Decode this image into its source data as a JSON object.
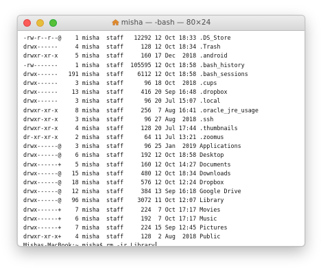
{
  "window": {
    "title": "misha — -bash — 80×24"
  },
  "icons": {
    "title_icon": "home-folder-icon"
  },
  "listing": [
    {
      "perms": "-rw-r--r--@",
      "links": "1",
      "owner": "misha",
      "group": "staff",
      "size": "12292",
      "month": "12",
      "day": "Oct",
      "time": "18:33",
      "name": ".DS_Store"
    },
    {
      "perms": "drwx------",
      "links": "4",
      "owner": "misha",
      "group": "staff",
      "size": "128",
      "month": "12",
      "day": "Oct",
      "time": "18:34",
      "name": ".Trash"
    },
    {
      "perms": "drwxr-xr-x",
      "links": "5",
      "owner": "misha",
      "group": "staff",
      "size": "160",
      "month": "17",
      "day": "Dec",
      "time": " 2018",
      "name": ".android"
    },
    {
      "perms": "-rw-------",
      "links": "1",
      "owner": "misha",
      "group": "staff",
      "size": "105595",
      "month": "12",
      "day": "Oct",
      "time": "18:58",
      "name": ".bash_history"
    },
    {
      "perms": "drwx------",
      "links": "191",
      "owner": "misha",
      "group": "staff",
      "size": "6112",
      "month": "12",
      "day": "Oct",
      "time": "18:58",
      "name": ".bash_sessions"
    },
    {
      "perms": "drwx------",
      "links": "3",
      "owner": "misha",
      "group": "staff",
      "size": "96",
      "month": "18",
      "day": "Oct",
      "time": " 2018",
      "name": ".cups"
    },
    {
      "perms": "drwx------",
      "links": "13",
      "owner": "misha",
      "group": "staff",
      "size": "416",
      "month": "20",
      "day": "Sep",
      "time": "16:48",
      "name": ".dropbox"
    },
    {
      "perms": "drwx------",
      "links": "3",
      "owner": "misha",
      "group": "staff",
      "size": "96",
      "month": "20",
      "day": "Jul",
      "time": "15:07",
      "name": ".local"
    },
    {
      "perms": "drwxr-xr-x",
      "links": "8",
      "owner": "misha",
      "group": "staff",
      "size": "256",
      "month": " 7",
      "day": "Aug",
      "time": "16:41",
      "name": ".oracle_jre_usage"
    },
    {
      "perms": "drwxr-xr-x",
      "links": "3",
      "owner": "misha",
      "group": "staff",
      "size": "96",
      "month": "27",
      "day": "Aug",
      "time": " 2018",
      "name": ".ssh"
    },
    {
      "perms": "drwxr-xr-x",
      "links": "4",
      "owner": "misha",
      "group": "staff",
      "size": "128",
      "month": "20",
      "day": "Jul",
      "time": "17:44",
      "name": ".thumbnails"
    },
    {
      "perms": "dr-xr-xr-x",
      "links": "2",
      "owner": "misha",
      "group": "staff",
      "size": "64",
      "month": "11",
      "day": "Jul",
      "time": "13:21",
      "name": ".zoomus"
    },
    {
      "perms": "drwx------@",
      "links": "3",
      "owner": "misha",
      "group": "staff",
      "size": "96",
      "month": "25",
      "day": "Jan",
      "time": " 2019",
      "name": "Applications"
    },
    {
      "perms": "drwx------@",
      "links": "6",
      "owner": "misha",
      "group": "staff",
      "size": "192",
      "month": "12",
      "day": "Oct",
      "time": "18:58",
      "name": "Desktop"
    },
    {
      "perms": "drwx------+",
      "links": "5",
      "owner": "misha",
      "group": "staff",
      "size": "160",
      "month": "12",
      "day": "Oct",
      "time": "14:27",
      "name": "Documents"
    },
    {
      "perms": "drwx------@",
      "links": "15",
      "owner": "misha",
      "group": "staff",
      "size": "480",
      "month": "12",
      "day": "Oct",
      "time": "18:34",
      "name": "Downloads"
    },
    {
      "perms": "drwx------@",
      "links": "18",
      "owner": "misha",
      "group": "staff",
      "size": "576",
      "month": "12",
      "day": "Oct",
      "time": "12:24",
      "name": "Dropbox"
    },
    {
      "perms": "drwx------@",
      "links": "12",
      "owner": "misha",
      "group": "staff",
      "size": "384",
      "month": "13",
      "day": "Sep",
      "time": "16:18",
      "name": "Google Drive"
    },
    {
      "perms": "drwx------@",
      "links": "96",
      "owner": "misha",
      "group": "staff",
      "size": "3072",
      "month": "11",
      "day": "Oct",
      "time": "12:07",
      "name": "Library"
    },
    {
      "perms": "drwx------+",
      "links": "7",
      "owner": "misha",
      "group": "staff",
      "size": "224",
      "month": " 7",
      "day": "Oct",
      "time": "17:17",
      "name": "Movies"
    },
    {
      "perms": "drwx------+",
      "links": "6",
      "owner": "misha",
      "group": "staff",
      "size": "192",
      "month": " 7",
      "day": "Oct",
      "time": "17:17",
      "name": "Music"
    },
    {
      "perms": "drwx------+",
      "links": "7",
      "owner": "misha",
      "group": "staff",
      "size": "224",
      "month": "15",
      "day": "Sep",
      "time": "12:45",
      "name": "Pictures"
    },
    {
      "perms": "drwxr-xr-x+",
      "links": "4",
      "owner": "misha",
      "group": "staff",
      "size": "128",
      "month": " 2",
      "day": "Aug",
      "time": " 2018",
      "name": "Public"
    }
  ],
  "prompt": {
    "text": "Mishas-MacBook:~ misha$ ",
    "command": "rm -ir Library"
  }
}
